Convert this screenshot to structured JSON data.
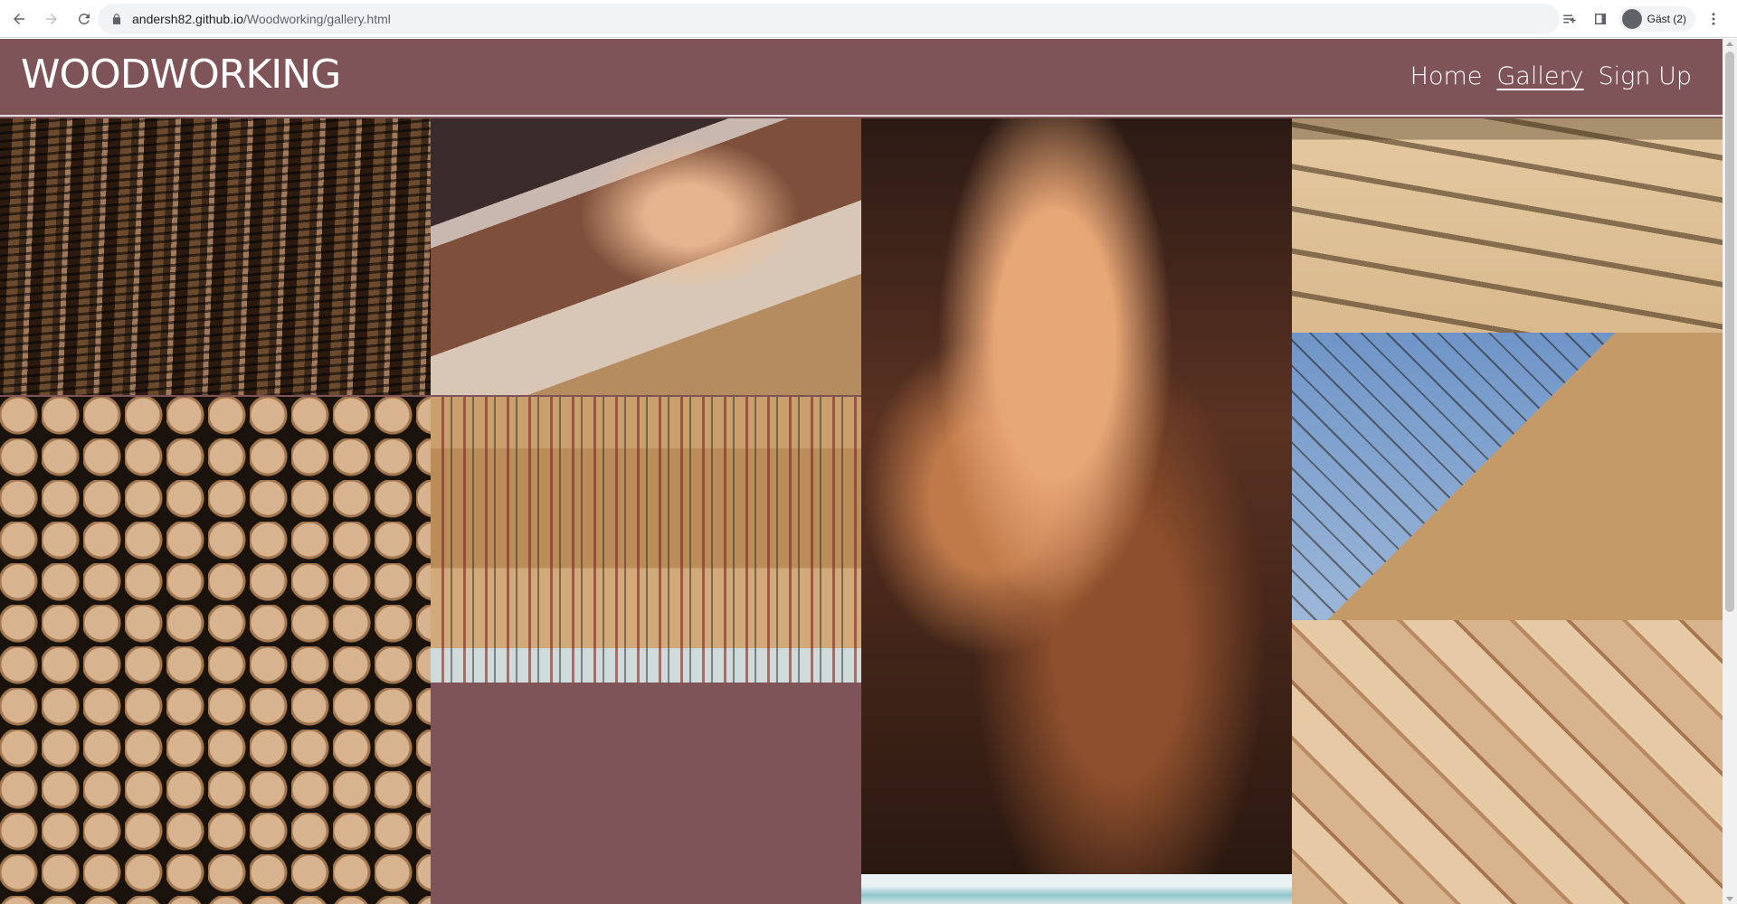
{
  "browser": {
    "url_domain": "andersh82.github.io",
    "url_path": "/Woodworking/gallery.html",
    "profile_label": "Gäst (2)"
  },
  "header": {
    "logo": "WOODWORKING",
    "nav": [
      {
        "label": "Home",
        "active": false
      },
      {
        "label": "Gallery",
        "active": true
      },
      {
        "label": "Sign Up",
        "active": false
      }
    ]
  },
  "gallery": {
    "images": [
      {
        "subject": "stacked-lumber"
      },
      {
        "subject": "hand-saw-cutting"
      },
      {
        "subject": "wood-shavings"
      },
      {
        "subject": "chisels-on-board"
      },
      {
        "subject": "log-ends"
      },
      {
        "subject": "tool-wall"
      },
      {
        "subject": "wooden-steps-sky"
      },
      {
        "subject": "parquet-square"
      },
      {
        "subject": "sky-clouds"
      }
    ]
  },
  "colors": {
    "brand": "#7e5458",
    "text": "#ffffff"
  }
}
